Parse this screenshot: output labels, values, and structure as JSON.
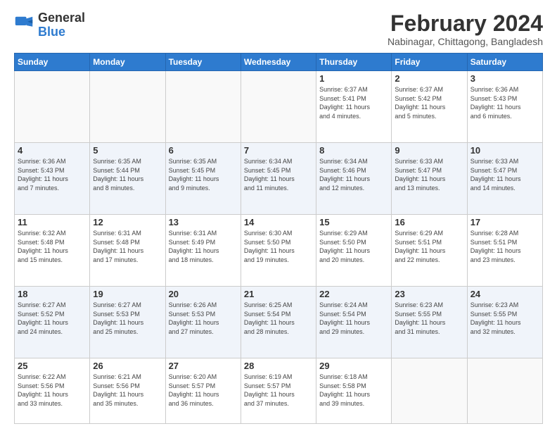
{
  "header": {
    "logo_general": "General",
    "logo_blue": "Blue",
    "month_title": "February 2024",
    "location": "Nabinagar, Chittagong, Bangladesh"
  },
  "weekdays": [
    "Sunday",
    "Monday",
    "Tuesday",
    "Wednesday",
    "Thursday",
    "Friday",
    "Saturday"
  ],
  "weeks": [
    [
      {
        "day": "",
        "info": ""
      },
      {
        "day": "",
        "info": ""
      },
      {
        "day": "",
        "info": ""
      },
      {
        "day": "",
        "info": ""
      },
      {
        "day": "1",
        "info": "Sunrise: 6:37 AM\nSunset: 5:41 PM\nDaylight: 11 hours\nand 4 minutes."
      },
      {
        "day": "2",
        "info": "Sunrise: 6:37 AM\nSunset: 5:42 PM\nDaylight: 11 hours\nand 5 minutes."
      },
      {
        "day": "3",
        "info": "Sunrise: 6:36 AM\nSunset: 5:43 PM\nDaylight: 11 hours\nand 6 minutes."
      }
    ],
    [
      {
        "day": "4",
        "info": "Sunrise: 6:36 AM\nSunset: 5:43 PM\nDaylight: 11 hours\nand 7 minutes."
      },
      {
        "day": "5",
        "info": "Sunrise: 6:35 AM\nSunset: 5:44 PM\nDaylight: 11 hours\nand 8 minutes."
      },
      {
        "day": "6",
        "info": "Sunrise: 6:35 AM\nSunset: 5:45 PM\nDaylight: 11 hours\nand 9 minutes."
      },
      {
        "day": "7",
        "info": "Sunrise: 6:34 AM\nSunset: 5:45 PM\nDaylight: 11 hours\nand 11 minutes."
      },
      {
        "day": "8",
        "info": "Sunrise: 6:34 AM\nSunset: 5:46 PM\nDaylight: 11 hours\nand 12 minutes."
      },
      {
        "day": "9",
        "info": "Sunrise: 6:33 AM\nSunset: 5:47 PM\nDaylight: 11 hours\nand 13 minutes."
      },
      {
        "day": "10",
        "info": "Sunrise: 6:33 AM\nSunset: 5:47 PM\nDaylight: 11 hours\nand 14 minutes."
      }
    ],
    [
      {
        "day": "11",
        "info": "Sunrise: 6:32 AM\nSunset: 5:48 PM\nDaylight: 11 hours\nand 15 minutes."
      },
      {
        "day": "12",
        "info": "Sunrise: 6:31 AM\nSunset: 5:48 PM\nDaylight: 11 hours\nand 17 minutes."
      },
      {
        "day": "13",
        "info": "Sunrise: 6:31 AM\nSunset: 5:49 PM\nDaylight: 11 hours\nand 18 minutes."
      },
      {
        "day": "14",
        "info": "Sunrise: 6:30 AM\nSunset: 5:50 PM\nDaylight: 11 hours\nand 19 minutes."
      },
      {
        "day": "15",
        "info": "Sunrise: 6:29 AM\nSunset: 5:50 PM\nDaylight: 11 hours\nand 20 minutes."
      },
      {
        "day": "16",
        "info": "Sunrise: 6:29 AM\nSunset: 5:51 PM\nDaylight: 11 hours\nand 22 minutes."
      },
      {
        "day": "17",
        "info": "Sunrise: 6:28 AM\nSunset: 5:51 PM\nDaylight: 11 hours\nand 23 minutes."
      }
    ],
    [
      {
        "day": "18",
        "info": "Sunrise: 6:27 AM\nSunset: 5:52 PM\nDaylight: 11 hours\nand 24 minutes."
      },
      {
        "day": "19",
        "info": "Sunrise: 6:27 AM\nSunset: 5:53 PM\nDaylight: 11 hours\nand 25 minutes."
      },
      {
        "day": "20",
        "info": "Sunrise: 6:26 AM\nSunset: 5:53 PM\nDaylight: 11 hours\nand 27 minutes."
      },
      {
        "day": "21",
        "info": "Sunrise: 6:25 AM\nSunset: 5:54 PM\nDaylight: 11 hours\nand 28 minutes."
      },
      {
        "day": "22",
        "info": "Sunrise: 6:24 AM\nSunset: 5:54 PM\nDaylight: 11 hours\nand 29 minutes."
      },
      {
        "day": "23",
        "info": "Sunrise: 6:23 AM\nSunset: 5:55 PM\nDaylight: 11 hours\nand 31 minutes."
      },
      {
        "day": "24",
        "info": "Sunrise: 6:23 AM\nSunset: 5:55 PM\nDaylight: 11 hours\nand 32 minutes."
      }
    ],
    [
      {
        "day": "25",
        "info": "Sunrise: 6:22 AM\nSunset: 5:56 PM\nDaylight: 11 hours\nand 33 minutes."
      },
      {
        "day": "26",
        "info": "Sunrise: 6:21 AM\nSunset: 5:56 PM\nDaylight: 11 hours\nand 35 minutes."
      },
      {
        "day": "27",
        "info": "Sunrise: 6:20 AM\nSunset: 5:57 PM\nDaylight: 11 hours\nand 36 minutes."
      },
      {
        "day": "28",
        "info": "Sunrise: 6:19 AM\nSunset: 5:57 PM\nDaylight: 11 hours\nand 37 minutes."
      },
      {
        "day": "29",
        "info": "Sunrise: 6:18 AM\nSunset: 5:58 PM\nDaylight: 11 hours\nand 39 minutes."
      },
      {
        "day": "",
        "info": ""
      },
      {
        "day": "",
        "info": ""
      }
    ]
  ]
}
